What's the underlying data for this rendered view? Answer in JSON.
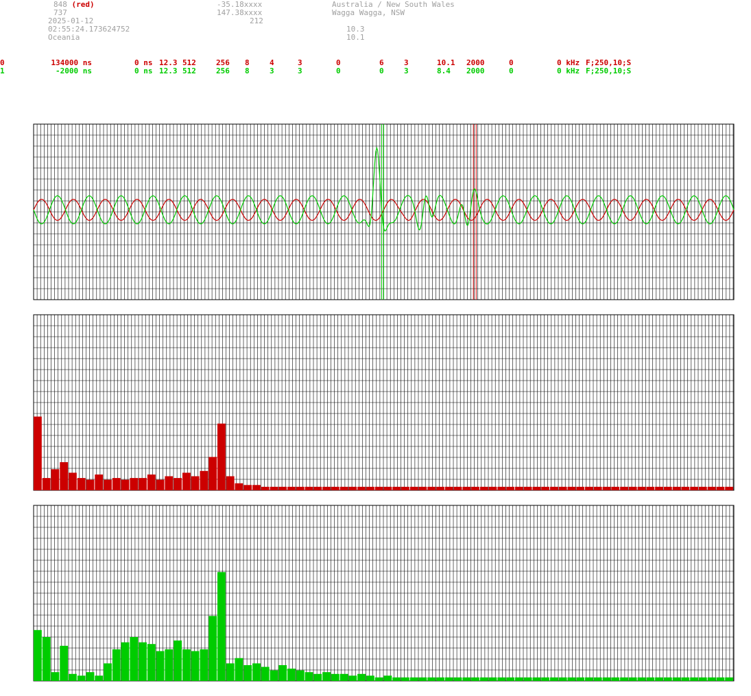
{
  "header": {
    "station_id": "848",
    "station_color_label": "(red)",
    "station_number": "737",
    "date": "2025-01-12",
    "time": "02:55:24.173624752",
    "region": "Oceania",
    "latitude": "-35.18xxxx",
    "longitude": "147.38xxxx",
    "altitude": "212",
    "country": "Australia / New South Wales",
    "city": "Wagga Wagga, NSW",
    "value_a": "10.3",
    "value_b": "10.1"
  },
  "channels": [
    {
      "color": "#cc0000",
      "fields": [
        "0",
        "134000 ns",
        "0 ns",
        "12.3",
        "512",
        "256",
        "8",
        "4",
        "3",
        "0",
        "6",
        "3",
        "10.1",
        "2000",
        "0",
        "0 kHz",
        "F;250,10;S"
      ]
    },
    {
      "color": "#00cc00",
      "fields": [
        "1",
        "-2000 ns",
        "0 ns",
        "12.3",
        "512",
        "256",
        "8",
        "3",
        "3",
        "0",
        "0",
        "3",
        "8.4",
        "2000",
        "0",
        "0 kHz",
        "F;250,10;S"
      ]
    }
  ],
  "colors": {
    "red": "#cc0000",
    "green": "#00cc00",
    "grid": "#000000",
    "header_text": "#a0a0a0"
  },
  "chart_data": [
    {
      "type": "line",
      "name": "waveform",
      "grid": true,
      "ylim": [
        -1,
        1
      ],
      "series": [
        {
          "color": "#cc0000",
          "cycles": 22,
          "amplitude": 0.12,
          "phase": 0.0,
          "pulses": [
            {
              "at": 0.528,
              "amp": 0.02
            }
          ],
          "markers": [
            0.628,
            0.632
          ]
        },
        {
          "color": "#00cc00",
          "cycles": 22,
          "amplitude": 0.16,
          "phase": 3.14,
          "pulses": [
            {
              "at": 0.49,
              "amp": 0.55
            },
            {
              "at": 0.56,
              "amp": 0.3
            },
            {
              "at": 0.62,
              "amp": -0.3
            }
          ],
          "markers": [
            0.497,
            0.5
          ]
        }
      ]
    },
    {
      "type": "bar",
      "name": "spectrum-red",
      "grid": true,
      "ylim": [
        0,
        1
      ],
      "color": "#cc0000",
      "values": [
        0.42,
        0.07,
        0.12,
        0.16,
        0.1,
        0.07,
        0.06,
        0.09,
        0.06,
        0.07,
        0.06,
        0.07,
        0.07,
        0.09,
        0.06,
        0.08,
        0.07,
        0.1,
        0.08,
        0.11,
        0.19,
        0.38,
        0.08,
        0.04,
        0.03,
        0.03,
        0.02,
        0.02,
        0.02,
        0.02,
        0.02,
        0.02,
        0.02,
        0.02,
        0.02,
        0.02,
        0.02,
        0.02,
        0.02,
        0.02,
        0.02,
        0.02,
        0.02,
        0.02,
        0.02,
        0.02,
        0.02,
        0.02,
        0.02,
        0.02,
        0.02,
        0.02,
        0.02,
        0.02,
        0.02,
        0.02,
        0.02,
        0.02,
        0.02,
        0.02,
        0.02,
        0.02,
        0.02,
        0.02,
        0.02,
        0.02,
        0.02,
        0.02,
        0.02,
        0.02,
        0.02,
        0.02,
        0.02,
        0.02,
        0.02,
        0.02,
        0.02,
        0.02,
        0.02,
        0.02
      ]
    },
    {
      "type": "bar",
      "name": "spectrum-green",
      "grid": true,
      "ylim": [
        0,
        1
      ],
      "color": "#00cc00",
      "values": [
        0.29,
        0.25,
        0.05,
        0.2,
        0.04,
        0.03,
        0.05,
        0.03,
        0.1,
        0.18,
        0.22,
        0.25,
        0.22,
        0.21,
        0.17,
        0.18,
        0.23,
        0.18,
        0.17,
        0.18,
        0.37,
        0.62,
        0.1,
        0.13,
        0.09,
        0.1,
        0.08,
        0.06,
        0.09,
        0.07,
        0.06,
        0.05,
        0.04,
        0.05,
        0.04,
        0.04,
        0.03,
        0.04,
        0.03,
        0.02,
        0.03,
        0.02,
        0.02,
        0.02,
        0.02,
        0.02,
        0.02,
        0.02,
        0.02,
        0.02,
        0.02,
        0.02,
        0.02,
        0.02,
        0.02,
        0.02,
        0.02,
        0.02,
        0.02,
        0.02,
        0.02,
        0.02,
        0.02,
        0.02,
        0.02,
        0.02,
        0.02,
        0.02,
        0.02,
        0.02,
        0.02,
        0.02,
        0.02,
        0.02,
        0.02,
        0.02,
        0.02,
        0.02,
        0.02,
        0.02
      ]
    }
  ]
}
